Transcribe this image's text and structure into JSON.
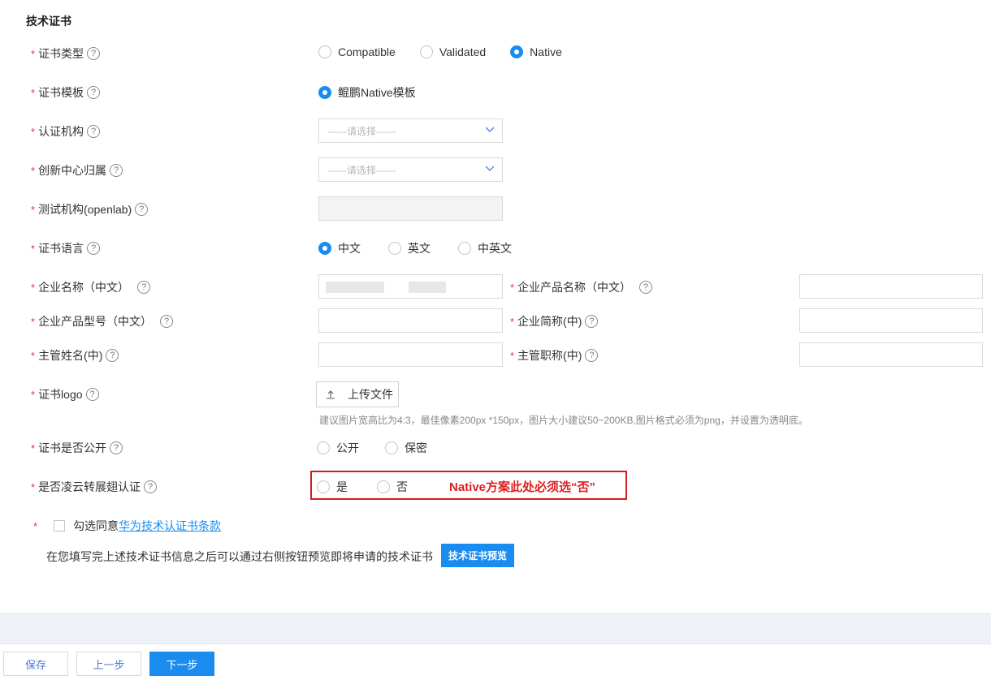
{
  "section_title": "技术证书",
  "help_icon": "?",
  "required_mark": "*",
  "fields": {
    "cert_type": {
      "label": "证书类型",
      "options": [
        "Compatible",
        "Validated",
        "Native"
      ],
      "selected": "Native"
    },
    "cert_template": {
      "label": "证书模板",
      "options": [
        "鲲鹏Native模板"
      ],
      "selected": "鲲鹏Native模板"
    },
    "cert_org": {
      "label": "认证机构",
      "placeholder": "------请选择------"
    },
    "innovation_center": {
      "label": "创新中心归属",
      "placeholder": "------请选择------"
    },
    "test_org": {
      "label": "测试机构(openlab)"
    },
    "cert_language": {
      "label": "证书语言",
      "options": [
        "中文",
        "英文",
        "中英文"
      ],
      "selected": "中文"
    },
    "company_name": {
      "label": "企业名称（中文）"
    },
    "product_name": {
      "label": "企业产品名称（中文）"
    },
    "product_model": {
      "label": "企业产品型号（中文）"
    },
    "company_short": {
      "label": "企业简称(中)"
    },
    "manager_name": {
      "label": "主管姓名(中)"
    },
    "manager_title": {
      "label": "主管职称(中)"
    },
    "cert_logo": {
      "label": "证书logo",
      "upload_label": "上传文件",
      "hint": "建议图片宽高比为4:3，最佳像素200px *150px，图片大小建议50~200KB,图片格式必须为png，并设置为透明底。"
    },
    "cert_public": {
      "label": "证书是否公开",
      "options": [
        "公开",
        "保密"
      ],
      "selected": ""
    },
    "lingyun": {
      "label": "是否凌云转展翅认证",
      "options": [
        "是",
        "否"
      ],
      "selected": "",
      "annotation": "Native方案此处必须选“否”"
    }
  },
  "agreement": {
    "prefix": "勾选同意",
    "link": "华为技术认证书条款"
  },
  "preview": {
    "text": "在您填写完上述技术证书信息之后可以通过右侧按钮预览即将申请的技术证书",
    "button": "技术证书预览"
  },
  "footer": {
    "save": "保存",
    "prev": "上一步",
    "next": "下一步"
  },
  "colors": {
    "primary": "#1a8cf0",
    "required": "#e0363c",
    "annotation": "#e02020"
  }
}
